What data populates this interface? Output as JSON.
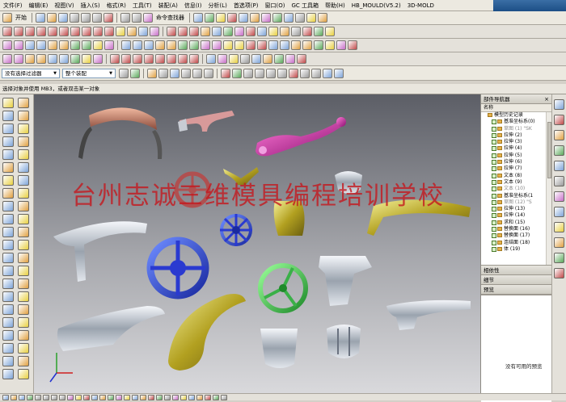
{
  "menubar": {
    "items": [
      "文件(F)",
      "编辑(E)",
      "视图(V)",
      "插入(S)",
      "格式(R)",
      "工具(T)",
      "装配(A)",
      "信息(I)",
      "分析(L)",
      "首选项(P)",
      "窗口(O)",
      "GC 工具箱",
      "帮助(H)",
      "HB_MOULD(V5.2)",
      "3D-MOLD"
    ]
  },
  "toolbar1": {
    "start_label": "开始",
    "cmd_finder_label": "命令查找器"
  },
  "selection_bar": {
    "filter_value": "没有选择过滤器",
    "assembly_value": "整个装配"
  },
  "hint": "选择对象并使用 MB3，或者双击某一对象",
  "watermark": "台州志诚三维模具编程培训学校",
  "part_navigator": {
    "title": "部件导航器",
    "column_header": "名称",
    "root": "模型历史记录",
    "rows": [
      {
        "label": "基准坐标系",
        "suffix": "(0)",
        "dim": false
      },
      {
        "label": "草图 (1) \"SK",
        "suffix": "",
        "dim": true
      },
      {
        "label": "拉伸 (2)",
        "suffix": "",
        "dim": false
      },
      {
        "label": "拉伸 (3)",
        "suffix": "",
        "dim": false
      },
      {
        "label": "拉伸 (4)",
        "suffix": "",
        "dim": false
      },
      {
        "label": "拉伸 (5)",
        "suffix": "",
        "dim": false
      },
      {
        "label": "拉伸 (6)",
        "suffix": "",
        "dim": false
      },
      {
        "label": "拉伸 (7)",
        "suffix": "",
        "dim": false
      },
      {
        "label": "文本 (8)",
        "suffix": "",
        "dim": false
      },
      {
        "label": "文本 (9)",
        "suffix": "",
        "dim": false
      },
      {
        "label": "文本 (10)",
        "suffix": "",
        "dim": true
      },
      {
        "label": "基准坐标系",
        "suffix": "(1",
        "dim": false
      },
      {
        "label": "草图 (12) \"S",
        "suffix": "",
        "dim": true
      },
      {
        "label": "拉伸 (13)",
        "suffix": "",
        "dim": false
      },
      {
        "label": "拉伸 (14)",
        "suffix": "",
        "dim": false
      },
      {
        "label": "求和 (15)",
        "suffix": "",
        "dim": false
      },
      {
        "label": "替换面 (16)",
        "suffix": "",
        "dim": false
      },
      {
        "label": "替换面 (17)",
        "suffix": "",
        "dim": false
      },
      {
        "label": "连结面 (18)",
        "suffix": "",
        "dim": false
      },
      {
        "label": "体 (19)",
        "suffix": "",
        "dim": false
      }
    ]
  },
  "panels": {
    "dependency": "相依性",
    "details": "细节",
    "preview": "预览",
    "preview_empty": "没有可用的预览"
  },
  "colors": {
    "watermark": "#c4181e",
    "viewport_top": "#5c5e66",
    "viewport_bottom": "#d9d9dc",
    "menu_bg": "#ece9e0"
  },
  "icons": {
    "close": "close-icon",
    "folder": "folder-icon",
    "checkbox": "checkbox-icon",
    "chevron": "chevron-down-icon"
  }
}
